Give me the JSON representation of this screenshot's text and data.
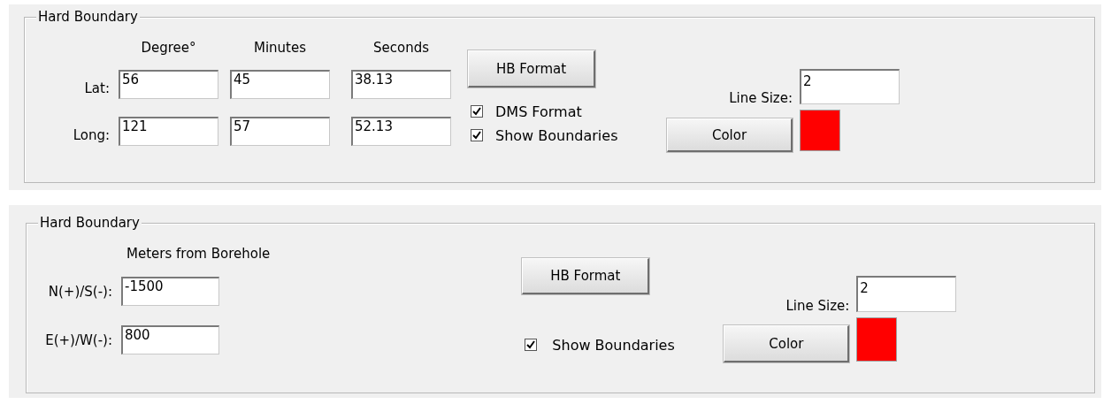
{
  "panels": [
    {
      "kind": "dms",
      "legend": "Hard Boundary",
      "column_headers": [
        "Degree°",
        "Minutes",
        "Seconds"
      ],
      "rows": [
        {
          "label": "Lat:",
          "values": [
            "56",
            "45",
            "38.13"
          ]
        },
        {
          "label": "Long:",
          "values": [
            "121",
            "57",
            "52.13"
          ]
        }
      ],
      "format_button": "HB Format",
      "checkboxes": [
        {
          "label": "DMS Format",
          "checked": true
        },
        {
          "label": "Show Boundaries",
          "checked": true
        }
      ],
      "line_size": {
        "label": "Line Size:",
        "value": "2"
      },
      "color_button": "Color",
      "color": "#ff0000"
    },
    {
      "kind": "offset",
      "legend": "Hard Boundary",
      "column_headers": [
        "Meters from Borehole"
      ],
      "rows": [
        {
          "label": "N(+)/S(-):",
          "values": [
            "-1500"
          ]
        },
        {
          "label": "E(+)/W(-):",
          "values": [
            "800"
          ]
        }
      ],
      "format_button": "HB Format",
      "checkboxes": [
        {
          "label": "Show Boundaries",
          "checked": true
        }
      ],
      "line_size": {
        "label": "Line Size:",
        "value": "2"
      },
      "color_button": "Color",
      "color": "#ff0000"
    }
  ]
}
